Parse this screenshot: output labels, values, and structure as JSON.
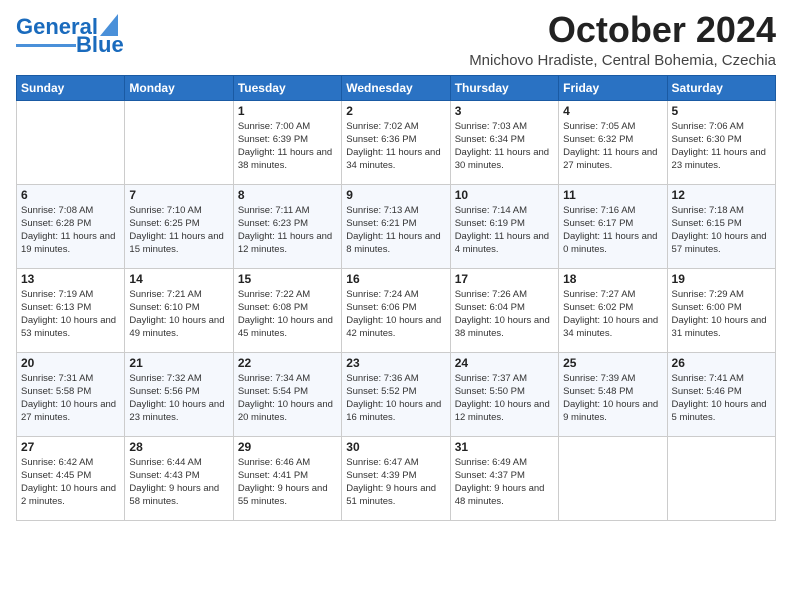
{
  "header": {
    "logo_line1": "General",
    "logo_line2": "Blue",
    "month_title": "October 2024",
    "location": "Mnichovo Hradiste, Central Bohemia, Czechia"
  },
  "days_of_week": [
    "Sunday",
    "Monday",
    "Tuesday",
    "Wednesday",
    "Thursday",
    "Friday",
    "Saturday"
  ],
  "weeks": [
    [
      {
        "day": "",
        "info": ""
      },
      {
        "day": "",
        "info": ""
      },
      {
        "day": "1",
        "info": "Sunrise: 7:00 AM\nSunset: 6:39 PM\nDaylight: 11 hours and 38 minutes."
      },
      {
        "day": "2",
        "info": "Sunrise: 7:02 AM\nSunset: 6:36 PM\nDaylight: 11 hours and 34 minutes."
      },
      {
        "day": "3",
        "info": "Sunrise: 7:03 AM\nSunset: 6:34 PM\nDaylight: 11 hours and 30 minutes."
      },
      {
        "day": "4",
        "info": "Sunrise: 7:05 AM\nSunset: 6:32 PM\nDaylight: 11 hours and 27 minutes."
      },
      {
        "day": "5",
        "info": "Sunrise: 7:06 AM\nSunset: 6:30 PM\nDaylight: 11 hours and 23 minutes."
      }
    ],
    [
      {
        "day": "6",
        "info": "Sunrise: 7:08 AM\nSunset: 6:28 PM\nDaylight: 11 hours and 19 minutes."
      },
      {
        "day": "7",
        "info": "Sunrise: 7:10 AM\nSunset: 6:25 PM\nDaylight: 11 hours and 15 minutes."
      },
      {
        "day": "8",
        "info": "Sunrise: 7:11 AM\nSunset: 6:23 PM\nDaylight: 11 hours and 12 minutes."
      },
      {
        "day": "9",
        "info": "Sunrise: 7:13 AM\nSunset: 6:21 PM\nDaylight: 11 hours and 8 minutes."
      },
      {
        "day": "10",
        "info": "Sunrise: 7:14 AM\nSunset: 6:19 PM\nDaylight: 11 hours and 4 minutes."
      },
      {
        "day": "11",
        "info": "Sunrise: 7:16 AM\nSunset: 6:17 PM\nDaylight: 11 hours and 0 minutes."
      },
      {
        "day": "12",
        "info": "Sunrise: 7:18 AM\nSunset: 6:15 PM\nDaylight: 10 hours and 57 minutes."
      }
    ],
    [
      {
        "day": "13",
        "info": "Sunrise: 7:19 AM\nSunset: 6:13 PM\nDaylight: 10 hours and 53 minutes."
      },
      {
        "day": "14",
        "info": "Sunrise: 7:21 AM\nSunset: 6:10 PM\nDaylight: 10 hours and 49 minutes."
      },
      {
        "day": "15",
        "info": "Sunrise: 7:22 AM\nSunset: 6:08 PM\nDaylight: 10 hours and 45 minutes."
      },
      {
        "day": "16",
        "info": "Sunrise: 7:24 AM\nSunset: 6:06 PM\nDaylight: 10 hours and 42 minutes."
      },
      {
        "day": "17",
        "info": "Sunrise: 7:26 AM\nSunset: 6:04 PM\nDaylight: 10 hours and 38 minutes."
      },
      {
        "day": "18",
        "info": "Sunrise: 7:27 AM\nSunset: 6:02 PM\nDaylight: 10 hours and 34 minutes."
      },
      {
        "day": "19",
        "info": "Sunrise: 7:29 AM\nSunset: 6:00 PM\nDaylight: 10 hours and 31 minutes."
      }
    ],
    [
      {
        "day": "20",
        "info": "Sunrise: 7:31 AM\nSunset: 5:58 PM\nDaylight: 10 hours and 27 minutes."
      },
      {
        "day": "21",
        "info": "Sunrise: 7:32 AM\nSunset: 5:56 PM\nDaylight: 10 hours and 23 minutes."
      },
      {
        "day": "22",
        "info": "Sunrise: 7:34 AM\nSunset: 5:54 PM\nDaylight: 10 hours and 20 minutes."
      },
      {
        "day": "23",
        "info": "Sunrise: 7:36 AM\nSunset: 5:52 PM\nDaylight: 10 hours and 16 minutes."
      },
      {
        "day": "24",
        "info": "Sunrise: 7:37 AM\nSunset: 5:50 PM\nDaylight: 10 hours and 12 minutes."
      },
      {
        "day": "25",
        "info": "Sunrise: 7:39 AM\nSunset: 5:48 PM\nDaylight: 10 hours and 9 minutes."
      },
      {
        "day": "26",
        "info": "Sunrise: 7:41 AM\nSunset: 5:46 PM\nDaylight: 10 hours and 5 minutes."
      }
    ],
    [
      {
        "day": "27",
        "info": "Sunrise: 6:42 AM\nSunset: 4:45 PM\nDaylight: 10 hours and 2 minutes."
      },
      {
        "day": "28",
        "info": "Sunrise: 6:44 AM\nSunset: 4:43 PM\nDaylight: 9 hours and 58 minutes."
      },
      {
        "day": "29",
        "info": "Sunrise: 6:46 AM\nSunset: 4:41 PM\nDaylight: 9 hours and 55 minutes."
      },
      {
        "day": "30",
        "info": "Sunrise: 6:47 AM\nSunset: 4:39 PM\nDaylight: 9 hours and 51 minutes."
      },
      {
        "day": "31",
        "info": "Sunrise: 6:49 AM\nSunset: 4:37 PM\nDaylight: 9 hours and 48 minutes."
      },
      {
        "day": "",
        "info": ""
      },
      {
        "day": "",
        "info": ""
      }
    ]
  ]
}
